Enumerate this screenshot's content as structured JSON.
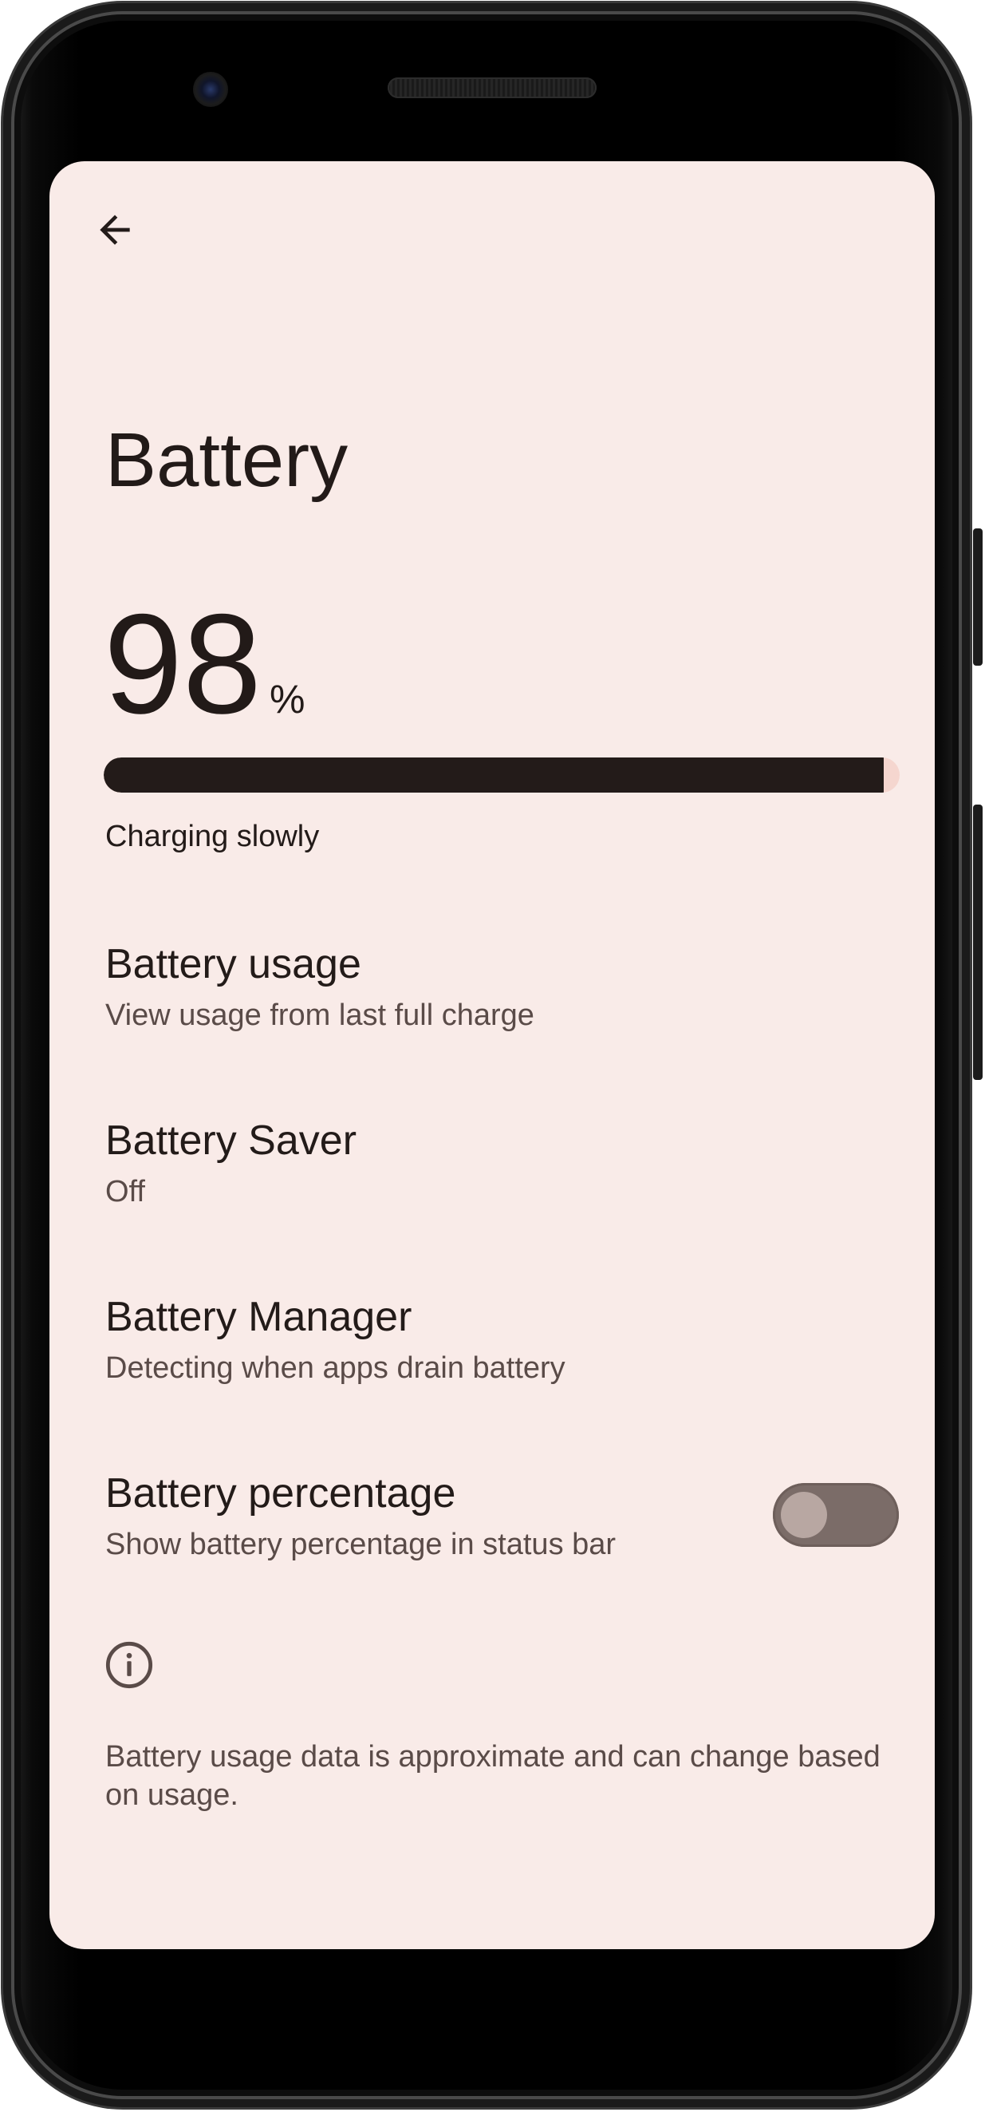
{
  "screen": {
    "back": {
      "icon": "arrow-back-icon"
    },
    "title": "Battery",
    "battery_level": {
      "value": "98",
      "unit": "%",
      "fraction": 0.98
    },
    "status": "Charging slowly",
    "preferences": [
      {
        "title": "Battery usage",
        "subtitle": "View usage from last full charge"
      },
      {
        "title": "Battery Saver",
        "subtitle": "Off"
      },
      {
        "title": "Battery Manager",
        "subtitle": "Detecting when apps drain battery"
      },
      {
        "title": "Battery percentage",
        "subtitle": "Show battery percentage in status bar",
        "toggle_on": false
      }
    ],
    "info_icon": "info-icon",
    "footer": "Battery usage data is approximate and can change based on usage."
  },
  "colors": {
    "background": "#f9ebe8",
    "text_primary": "#231b19",
    "text_secondary": "#5a4b48",
    "progress_fill": "#231b19",
    "progress_track": "#f5d6cf",
    "toggle_track": "#7b6c68",
    "toggle_knob": "#b8a7a2"
  }
}
